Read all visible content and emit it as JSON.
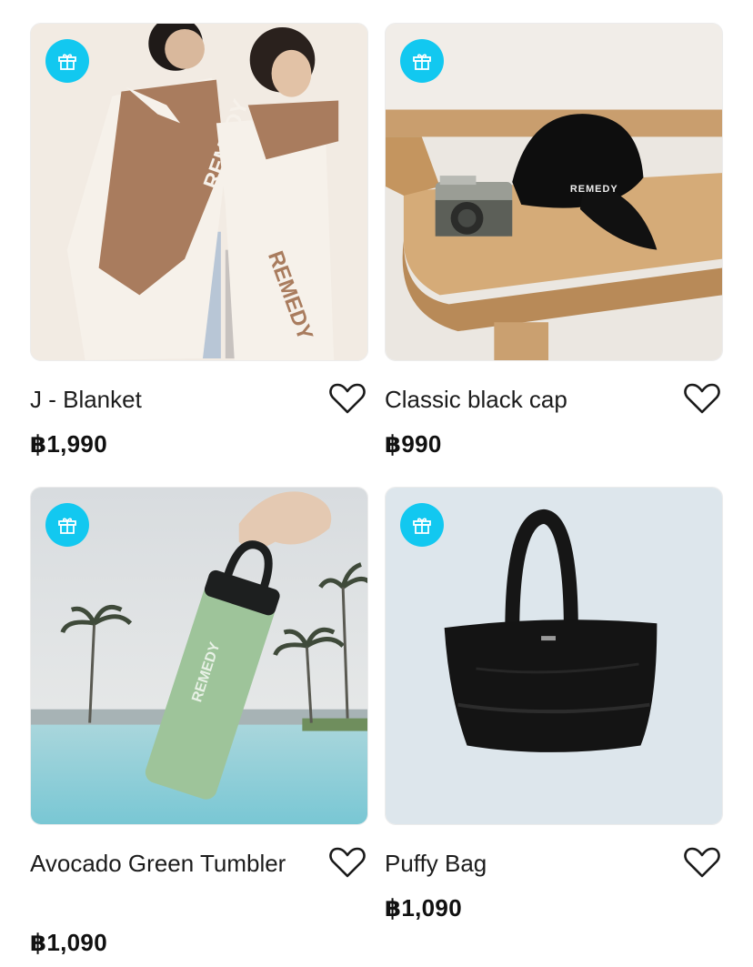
{
  "products": [
    {
      "name": "J - Blanket",
      "price": "฿1,990",
      "image": "blanket",
      "gift_icon": "gift-icon",
      "wishlist_icon": "heart-outline-icon",
      "brand_print": "REMEDY"
    },
    {
      "name": "Classic black cap",
      "price": "฿990",
      "image": "cap",
      "gift_icon": "gift-icon",
      "wishlist_icon": "heart-outline-icon",
      "brand_print": "REMEDY"
    },
    {
      "name": "Avocado Green Tumbler",
      "price": "฿1,090",
      "image": "tumbler",
      "gift_icon": "gift-icon",
      "wishlist_icon": "heart-outline-icon",
      "brand_print": "REMEDY"
    },
    {
      "name": "Puffy Bag",
      "price": "฿1,090",
      "image": "bag",
      "gift_icon": "gift-icon",
      "wishlist_icon": "heart-outline-icon",
      "brand_print": ""
    }
  ],
  "colors": {
    "gift_badge": "#12c8f0",
    "text": "#1c1c1c"
  }
}
